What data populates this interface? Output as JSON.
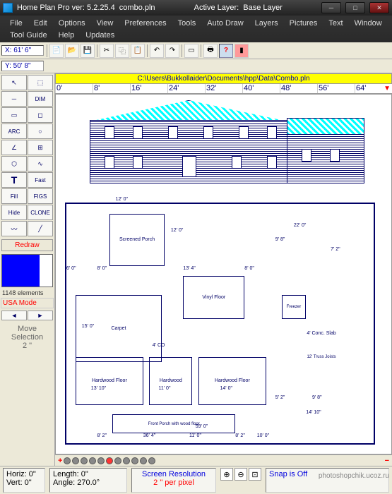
{
  "title": {
    "app": "Home Plan Pro ver: 5.2.25.4",
    "file": "combo.pln",
    "layer_label": "Active Layer:",
    "layer": "Base Layer"
  },
  "menu": [
    "File",
    "Edit",
    "Options",
    "View",
    "Preferences",
    "Tools",
    "Auto Draw",
    "Layers",
    "Pictures",
    "Text",
    "Window",
    "Tool Guide",
    "Help",
    "Updates"
  ],
  "coords": {
    "x": "X: 61' 6\"",
    "y": "Y: 50' 8\""
  },
  "path": "C:\\Users\\Bukkollaider\\Documents\\hpp\\Data\\Combo.pln",
  "ruler": [
    "0'",
    "8'",
    "16'",
    "24'",
    "32'",
    "40'",
    "48'",
    "56'",
    "64'"
  ],
  "palette": {
    "dim": "DIM",
    "arc": "ARC",
    "circle": "○",
    "txt": "T",
    "fast": "Fast",
    "fill": "Fill",
    "figs": "FIGS",
    "hide": "Hide",
    "clone": "CLONE",
    "redraw": "Redraw",
    "elements": "1148 elements",
    "usa": "USA Mode",
    "move": "Move Selection",
    "move_val": "2 \""
  },
  "plan": {
    "rooms": {
      "porch": "Screened Porch",
      "carpet": "Carpet",
      "vinyl": "Vinyl Floor",
      "hw1": "Hardwood Floor",
      "hw2": "Hardwood",
      "hw3": "Hardwood Floor",
      "freezer": "Freezer",
      "slab": "4' Conc. Slab",
      "joists": "12' Truss Joists",
      "front": "Front Porch with wood floor"
    },
    "dims": {
      "d1": "12' 0\"",
      "d2": "12' 0\"",
      "d3": "6' 0\"",
      "d4": "8' 0\"",
      "d5": "13' 4\"",
      "d6": "8' 0\"",
      "d7": "15' 0\"",
      "d8": "4' CO",
      "d9": "13' 10\"",
      "d10": "11' 0\"",
      "d11": "14' 0\"",
      "d12": "59' 0\"",
      "d13": "36' 4\"",
      "d14": "22' 0\"",
      "d15": "9' 8\"",
      "d16": "7' 2\"",
      "d17": "5' 2\"",
      "d18": "9' 8\"",
      "d19": "14' 10\"",
      "d20": "8' 2\"",
      "d21": "11' 0\"",
      "d22": "8' 2\"",
      "d23": "10' 0\""
    }
  },
  "status": {
    "horiz": "Horiz: 0\"",
    "vert": "Vert: 0\"",
    "length": "Length:  0\"",
    "angle": "Angle: 270.0°",
    "res_label": "Screen Resolution",
    "res_val": "2 \" per pixel",
    "snap": "Snap is Off"
  },
  "watermark": "photoshopchik.ucoz.ru"
}
